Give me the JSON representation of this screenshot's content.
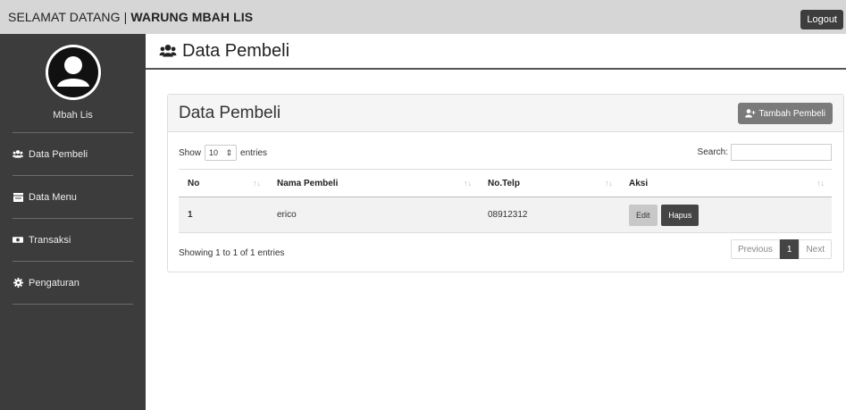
{
  "header": {
    "welcome": "SELAMAT DATANG |",
    "brand": "WARUNG MBAH LIS",
    "logout_label": "Logout"
  },
  "sidebar": {
    "username": "Mbah Lis",
    "items": [
      {
        "label": "Data Pembeli",
        "icon": "users-icon"
      },
      {
        "label": "Data Menu",
        "icon": "list-icon"
      },
      {
        "label": "Transaksi",
        "icon": "money-icon"
      },
      {
        "label": "Pengaturan",
        "icon": "gear-icon"
      }
    ]
  },
  "page": {
    "title": "Data Pembeli"
  },
  "panel": {
    "title": "Data Pembeli",
    "add_label": "Tambah Pembeli"
  },
  "table_controls": {
    "show_label": "Show",
    "entries_value": "10",
    "entries_label": "entries",
    "search_label": "Search:",
    "search_value": ""
  },
  "table": {
    "columns": [
      "No",
      "Nama Pembeli",
      "No.Telp",
      "Aksi"
    ],
    "rows": [
      {
        "no": "1",
        "nama": "erico",
        "telp": "08912312",
        "edit_label": "Edit",
        "hapus_label": "Hapus"
      }
    ]
  },
  "footer": {
    "info": "Showing 1 to 1 of 1 entries",
    "prev_label": "Previous",
    "page": "1",
    "next_label": "Next"
  },
  "colors": {
    "sidebar": "#3c3c3c",
    "topbar": "#d6d6d6"
  }
}
